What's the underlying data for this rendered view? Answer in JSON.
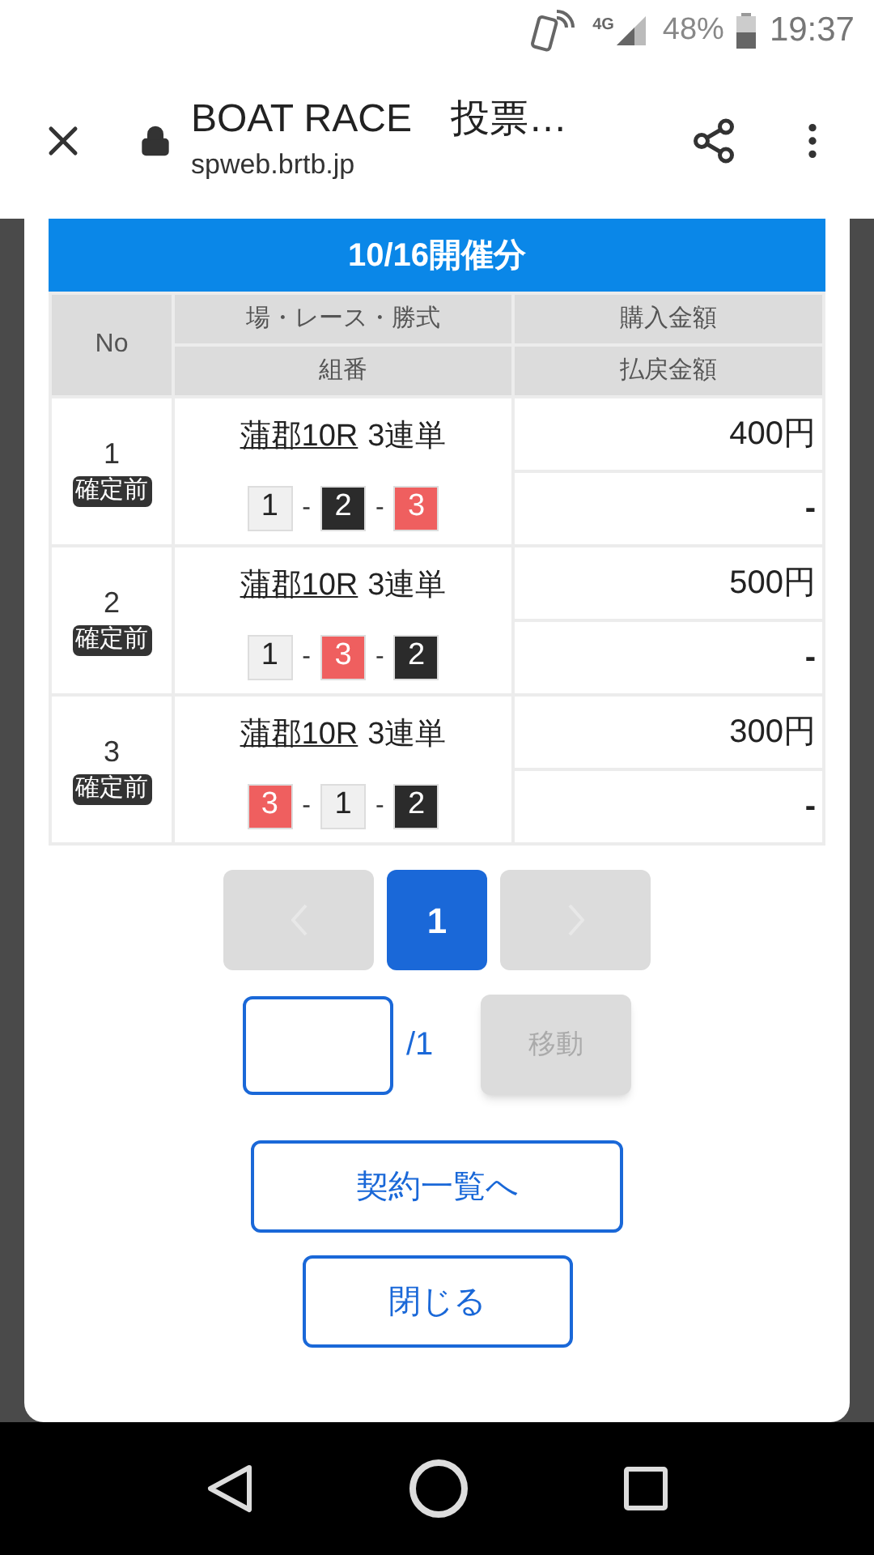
{
  "status_bar": {
    "network": "4G",
    "battery": "48%",
    "time": "19:37"
  },
  "browser": {
    "title": "BOAT RACE　投票…",
    "url": "spweb.brtb.jp"
  },
  "modal": {
    "heading": "10/16開催分",
    "columns": {
      "no": "No",
      "race": "場・レース・勝式",
      "combo": "組番",
      "bet": "購入金額",
      "payout": "払戻金額"
    },
    "rows": [
      {
        "no": "1",
        "status": "確定前",
        "race": "蒲郡10R",
        "bet_type": "3連単",
        "boats": [
          {
            "number": "1",
            "color": "#f0f0f0"
          },
          {
            "number": "2",
            "color": "#2b2b2b"
          },
          {
            "number": "3",
            "color": "#ef5f5f"
          }
        ],
        "bet": "400円",
        "payout": "-"
      },
      {
        "no": "2",
        "status": "確定前",
        "race": "蒲郡10R",
        "bet_type": "3連単",
        "boats": [
          {
            "number": "1",
            "color": "#f0f0f0"
          },
          {
            "number": "3",
            "color": "#ef5f5f"
          },
          {
            "number": "2",
            "color": "#2b2b2b"
          }
        ],
        "bet": "500円",
        "payout": "-"
      },
      {
        "no": "3",
        "status": "確定前",
        "race": "蒲郡10R",
        "bet_type": "3連単",
        "boats": [
          {
            "number": "3",
            "color": "#ef5f5f"
          },
          {
            "number": "1",
            "color": "#f0f0f0"
          },
          {
            "number": "2",
            "color": "#2b2b2b"
          }
        ],
        "bet": "300円",
        "payout": "-"
      }
    ],
    "separator": "-",
    "pager": {
      "prev_disabled": true,
      "next_disabled": true,
      "pages": [
        {
          "label": "1",
          "selected": true
        }
      ]
    },
    "jump": {
      "total": "/1",
      "button": "移動",
      "button_disabled": true
    },
    "buttons": [
      "契約一覧へ",
      "閉じる"
    ]
  }
}
